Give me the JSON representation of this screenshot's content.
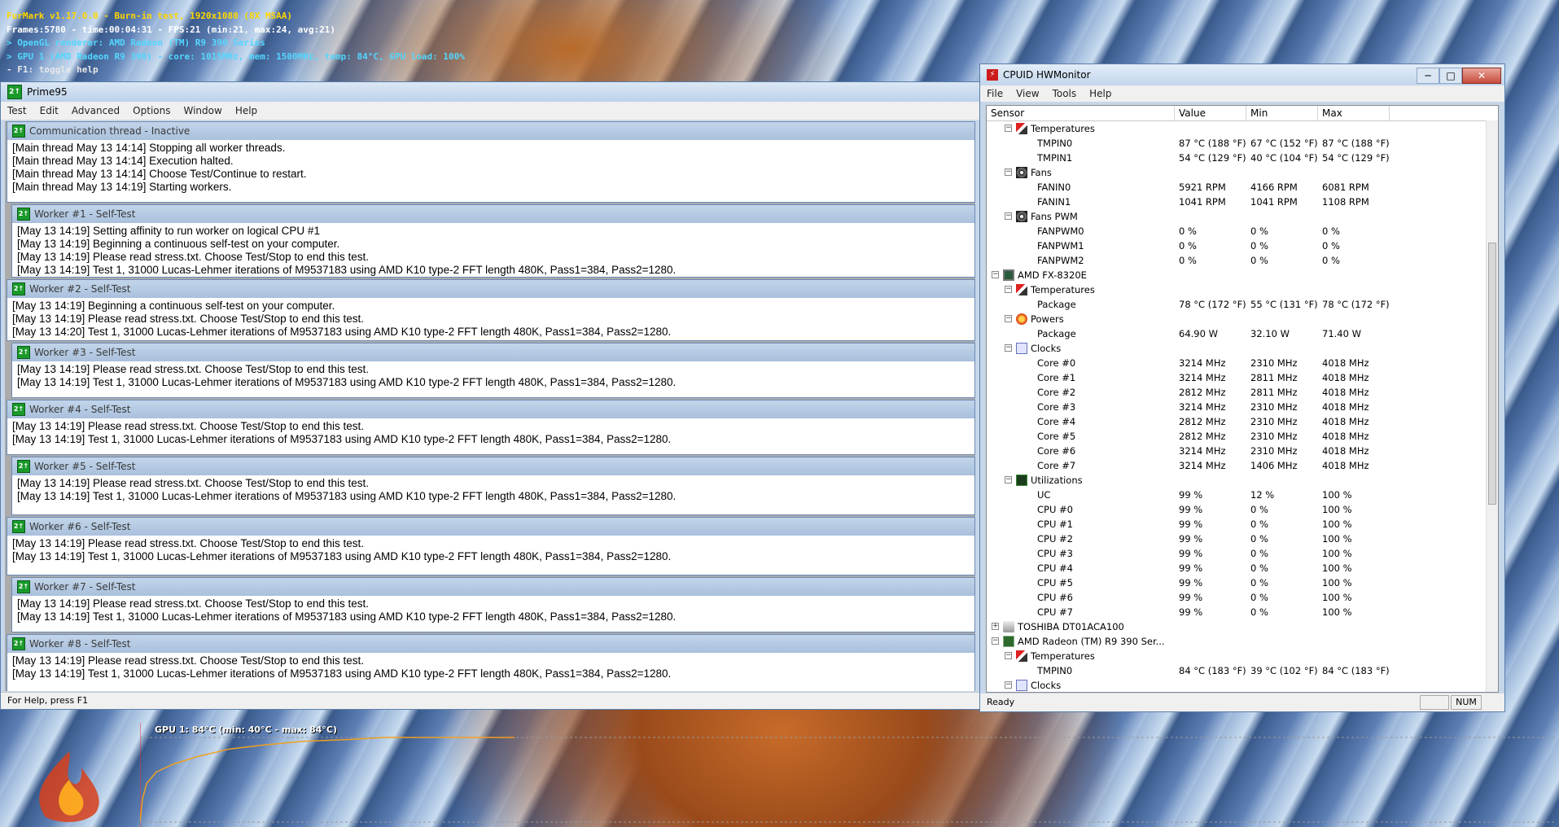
{
  "furmark": {
    "title": "FurMark v1.17.0.0 - Burn-in test, 1920x1080 (8X MSAA)",
    "frames": "Frames:5780 - time:00:04:31 - FPS:21 (min:21, max:24, avg:21)",
    "renderer": "> OpenGL renderer: AMD Radeon (TM) R9 390 Series",
    "gpu": "> GPU 1 (AMD Radeon R9 390) - core: 1015MHz, mem: 1500MHz, temp: 84°C, GPU load: 100%",
    "help": "- F1: toggle help",
    "graph_label": "GPU 1: 84°C (min: 40°C - max: 84°C)",
    "graph_color": "#f0a020"
  },
  "prime95": {
    "title": "Prime95",
    "menu": [
      "Test",
      "Edit",
      "Advanced",
      "Options",
      "Window",
      "Help"
    ],
    "status": "For Help, press F1",
    "windows": [
      {
        "title": "Communication thread - Inactive",
        "lines": [
          "[Main thread May 13 14:14] Stopping all worker threads.",
          "[Main thread May 13 14:14] Execution halted.",
          "[Main thread May 13 14:14] Choose Test/Continue to restart.",
          "[Main thread May 13 14:19] Starting workers."
        ]
      },
      {
        "title": "Worker #1 - Self-Test",
        "lines": [
          "[May 13 14:19] Setting affinity to run worker on logical CPU #1",
          "[May 13 14:19] Beginning a continuous self-test on your computer.",
          "[May 13 14:19] Please read stress.txt.  Choose Test/Stop to end this test.",
          "[May 13 14:19] Test 1, 31000 Lucas-Lehmer iterations of M9537183 using AMD K10 type-2 FFT length 480K, Pass1=384, Pass2=1280."
        ]
      },
      {
        "title": "Worker #2 - Self-Test",
        "lines": [
          "[May 13 14:19] Beginning a continuous self-test on your computer.",
          "[May 13 14:19] Please read stress.txt.  Choose Test/Stop to end this test.",
          "[May 13 14:20] Test 1, 31000 Lucas-Lehmer iterations of M9537183 using AMD K10 type-2 FFT length 480K, Pass1=384, Pass2=1280."
        ]
      },
      {
        "title": "Worker #3 - Self-Test",
        "lines": [
          "[May 13 14:19] Please read stress.txt.  Choose Test/Stop to end this test.",
          "[May 13 14:19] Test 1, 31000 Lucas-Lehmer iterations of M9537183 using AMD K10 type-2 FFT length 480K, Pass1=384, Pass2=1280."
        ]
      },
      {
        "title": "Worker #4 - Self-Test",
        "lines": [
          "[May 13 14:19] Please read stress.txt.  Choose Test/Stop to end this test.",
          "[May 13 14:19] Test 1, 31000 Lucas-Lehmer iterations of M9537183 using AMD K10 type-2 FFT length 480K, Pass1=384, Pass2=1280."
        ]
      },
      {
        "title": "Worker #5 - Self-Test",
        "lines": [
          "[May 13 14:19] Please read stress.txt.  Choose Test/Stop to end this test.",
          "[May 13 14:19] Test 1, 31000 Lucas-Lehmer iterations of M9537183 using AMD K10 type-2 FFT length 480K, Pass1=384, Pass2=1280."
        ]
      },
      {
        "title": "Worker #6 - Self-Test",
        "lines": [
          "[May 13 14:19] Please read stress.txt.  Choose Test/Stop to end this test.",
          "[May 13 14:19] Test 1, 31000 Lucas-Lehmer iterations of M9537183 using AMD K10 type-2 FFT length 480K, Pass1=384, Pass2=1280."
        ]
      },
      {
        "title": "Worker #7 - Self-Test",
        "lines": [
          "[May 13 14:19] Please read stress.txt.  Choose Test/Stop to end this test.",
          "[May 13 14:19] Test 1, 31000 Lucas-Lehmer iterations of M9537183 using AMD K10 type-2 FFT length 480K, Pass1=384, Pass2=1280."
        ]
      },
      {
        "title": "Worker #8 - Self-Test",
        "lines": [
          "[May 13 14:19] Please read stress.txt.  Choose Test/Stop to end this test.",
          "[May 13 14:19] Test 1, 31000 Lucas-Lehmer iterations of M9537183 using AMD K10 type-2 FFT length 480K, Pass1=384, Pass2=1280."
        ]
      }
    ]
  },
  "hwmonitor": {
    "title": "CPUID HWMonitor",
    "menu": [
      "File",
      "View",
      "Tools",
      "Help"
    ],
    "columns": [
      "Sensor",
      "Value",
      "Min",
      "Max"
    ],
    "status": "Ready",
    "num_indicator": "NUM",
    "rows": [
      {
        "level": 2,
        "icon": "thermometer-icon",
        "box": "−",
        "label": "Temperatures",
        "value": "",
        "min": "",
        "max": ""
      },
      {
        "level": 3,
        "label": "TMPIN0",
        "value": "87 °C  (188 °F)",
        "min": "67 °C  (152 °F)",
        "max": "87 °C  (188 °F)"
      },
      {
        "level": 3,
        "label": "TMPIN1",
        "value": "54 °C  (129 °F)",
        "min": "40 °C  (104 °F)",
        "max": "54 °C  (129 °F)"
      },
      {
        "level": 2,
        "icon": "fan-icon",
        "box": "−",
        "label": "Fans",
        "value": "",
        "min": "",
        "max": ""
      },
      {
        "level": 3,
        "label": "FANIN0",
        "value": "5921 RPM",
        "min": "4166 RPM",
        "max": "6081 RPM"
      },
      {
        "level": 3,
        "label": "FANIN1",
        "value": "1041 RPM",
        "min": "1041 RPM",
        "max": "1108 RPM"
      },
      {
        "level": 2,
        "icon": "fan-pwm-icon",
        "box": "−",
        "label": "Fans PWM",
        "value": "",
        "min": "",
        "max": ""
      },
      {
        "level": 3,
        "label": "FANPWM0",
        "value": "0 %",
        "min": "0 %",
        "max": "0 %"
      },
      {
        "level": 3,
        "label": "FANPWM1",
        "value": "0 %",
        "min": "0 %",
        "max": "0 %"
      },
      {
        "level": 3,
        "label": "FANPWM2",
        "value": "0 %",
        "min": "0 %",
        "max": "0 %"
      },
      {
        "level": 1,
        "icon": "cpu-chip-icon",
        "box": "−",
        "label": "AMD FX-8320E",
        "value": "",
        "min": "",
        "max": ""
      },
      {
        "level": 2,
        "icon": "thermometer-icon",
        "box": "−",
        "label": "Temperatures",
        "value": "",
        "min": "",
        "max": ""
      },
      {
        "level": 3,
        "label": "Package",
        "value": "78 °C  (172 °F)",
        "min": "55 °C  (131 °F)",
        "max": "78 °C  (172 °F)"
      },
      {
        "level": 2,
        "icon": "power-icon",
        "box": "−",
        "label": "Powers",
        "value": "",
        "min": "",
        "max": ""
      },
      {
        "level": 3,
        "label": "Package",
        "value": "64.90 W",
        "min": "32.10 W",
        "max": "71.40 W"
      },
      {
        "level": 2,
        "icon": "clock-icon",
        "box": "−",
        "label": "Clocks",
        "value": "",
        "min": "",
        "max": ""
      },
      {
        "level": 3,
        "label": "Core #0",
        "value": "3214 MHz",
        "min": "2310 MHz",
        "max": "4018 MHz"
      },
      {
        "level": 3,
        "label": "Core #1",
        "value": "3214 MHz",
        "min": "2811 MHz",
        "max": "4018 MHz"
      },
      {
        "level": 3,
        "label": "Core #2",
        "value": "2812 MHz",
        "min": "2811 MHz",
        "max": "4018 MHz"
      },
      {
        "level": 3,
        "label": "Core #3",
        "value": "3214 MHz",
        "min": "2310 MHz",
        "max": "4018 MHz"
      },
      {
        "level": 3,
        "label": "Core #4",
        "value": "2812 MHz",
        "min": "2310 MHz",
        "max": "4018 MHz"
      },
      {
        "level": 3,
        "label": "Core #5",
        "value": "2812 MHz",
        "min": "2310 MHz",
        "max": "4018 MHz"
      },
      {
        "level": 3,
        "label": "Core #6",
        "value": "3214 MHz",
        "min": "2310 MHz",
        "max": "4018 MHz"
      },
      {
        "level": 3,
        "label": "Core #7",
        "value": "3214 MHz",
        "min": "1406 MHz",
        "max": "4018 MHz"
      },
      {
        "level": 2,
        "icon": "utilization-icon",
        "box": "−",
        "label": "Utilizations",
        "value": "",
        "min": "",
        "max": ""
      },
      {
        "level": 3,
        "label": "UC",
        "value": "99 %",
        "min": "12 %",
        "max": "100 %"
      },
      {
        "level": 3,
        "label": "CPU #0",
        "value": "99 %",
        "min": "0 %",
        "max": "100 %"
      },
      {
        "level": 3,
        "label": "CPU #1",
        "value": "99 %",
        "min": "0 %",
        "max": "100 %"
      },
      {
        "level": 3,
        "label": "CPU #2",
        "value": "99 %",
        "min": "0 %",
        "max": "100 %"
      },
      {
        "level": 3,
        "label": "CPU #3",
        "value": "99 %",
        "min": "0 %",
        "max": "100 %"
      },
      {
        "level": 3,
        "label": "CPU #4",
        "value": "99 %",
        "min": "0 %",
        "max": "100 %"
      },
      {
        "level": 3,
        "label": "CPU #5",
        "value": "99 %",
        "min": "0 %",
        "max": "100 %"
      },
      {
        "level": 3,
        "label": "CPU #6",
        "value": "99 %",
        "min": "0 %",
        "max": "100 %"
      },
      {
        "level": 3,
        "label": "CPU #7",
        "value": "99 %",
        "min": "0 %",
        "max": "100 %"
      },
      {
        "level": 1,
        "icon": "disk-icon",
        "box": "+",
        "label": "TOSHIBA DT01ACA100",
        "value": "",
        "min": "",
        "max": ""
      },
      {
        "level": 1,
        "icon": "gpu-icon",
        "box": "−",
        "label": "AMD Radeon (TM) R9 390 Ser...",
        "value": "",
        "min": "",
        "max": ""
      },
      {
        "level": 2,
        "icon": "thermometer-icon",
        "box": "−",
        "label": "Temperatures",
        "value": "",
        "min": "",
        "max": ""
      },
      {
        "level": 3,
        "label": "TMPIN0",
        "value": "84 °C  (183 °F)",
        "min": "39 °C  (102 °F)",
        "max": "84 °C  (183 °F)"
      },
      {
        "level": 2,
        "icon": "clock-icon",
        "box": "−",
        "label": "Clocks",
        "value": "",
        "min": "",
        "max": ""
      }
    ]
  }
}
